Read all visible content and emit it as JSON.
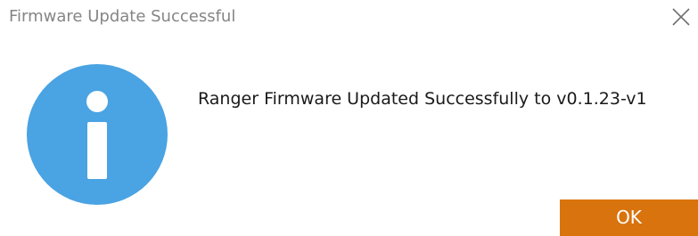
{
  "dialog": {
    "title": "Firmware Update Successful",
    "message": "Ranger Firmware Updated Successfully to v0.1.23-v1",
    "ok_label": "OK",
    "icon": "info-icon",
    "close_icon": "close-icon"
  },
  "colors": {
    "title_text": "#858585",
    "info_icon": "#4aa3e2",
    "ok_button": "#d9730d",
    "ok_text": "#ffffff"
  }
}
